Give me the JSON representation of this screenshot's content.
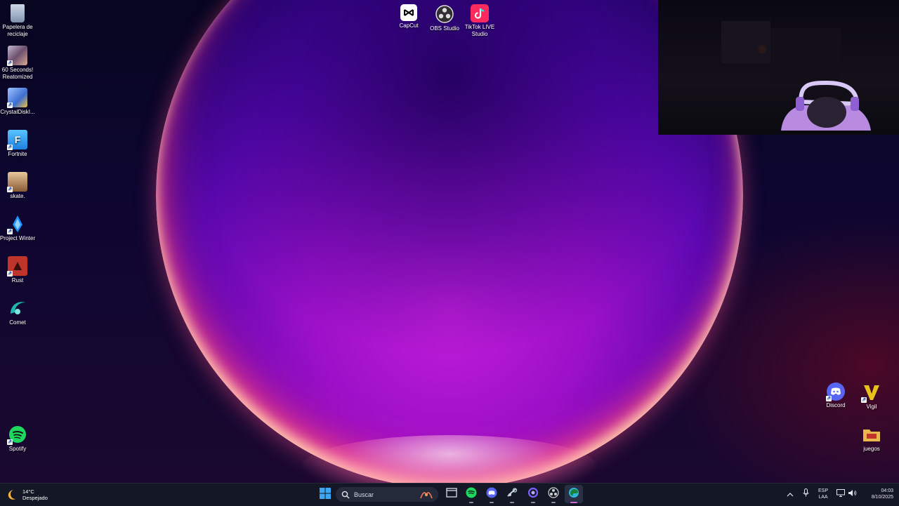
{
  "desktop": {
    "icons_left": [
      {
        "label": "Papelera de reciclaje",
        "icon": "recycle-bin-icon",
        "color": "#9fb6cf"
      },
      {
        "label": "60 Seconds! Reatomized",
        "icon": "game-60-seconds-icon",
        "color": "#8a6d8c"
      },
      {
        "label": "CrystalDiskI...",
        "icon": "crystaldiskinfo-icon",
        "color": "#4d7dd1"
      },
      {
        "label": "Fortnite",
        "icon": "fortnite-icon",
        "color": "#3aa0f2"
      },
      {
        "label": "skate.",
        "icon": "skate-icon",
        "color": "#b88a5d"
      },
      {
        "label": "Project Winter",
        "icon": "project-winter-icon",
        "color": "#1e90ff"
      },
      {
        "label": "Rust",
        "icon": "rust-icon",
        "color": "#c0352b"
      },
      {
        "label": "Comet",
        "icon": "comet-icon",
        "color": "#1fb5b0"
      },
      {
        "label": "Spotify",
        "icon": "spotify-icon",
        "color": "#1ed760"
      }
    ],
    "icons_top": [
      {
        "label": "CapCut",
        "icon": "capcut-icon",
        "color": "#ffffff"
      },
      {
        "label": "OBS Studio",
        "icon": "obs-studio-icon",
        "color": "#302e31"
      },
      {
        "label": "TikTok LIVE Studio",
        "icon": "tiktok-live-icon",
        "color": "#ff2b5e"
      }
    ],
    "icons_right": [
      {
        "label": "Discord",
        "icon": "discord-icon",
        "color": "#5865f2"
      },
      {
        "label": "Vigil",
        "icon": "vigil-icon",
        "color": "#e8c21a"
      },
      {
        "label": "juegos",
        "icon": "folder-icon",
        "color": "#e8b84a"
      }
    ]
  },
  "taskbar": {
    "weather": {
      "temp": "14°C",
      "condition": "Despejado",
      "icon": "moon-icon"
    },
    "search_placeholder": "Buscar",
    "apps": [
      {
        "name": "file-explorer",
        "icon": "file-explorer-icon",
        "color": "#d9dde6"
      },
      {
        "name": "spotify",
        "icon": "spotify-icon",
        "color": "#1ed760"
      },
      {
        "name": "discord",
        "icon": "discord-icon",
        "color": "#5865f2"
      },
      {
        "name": "steam",
        "icon": "steam-icon",
        "color": "#c7d5e0"
      },
      {
        "name": "comet",
        "icon": "comet-icon",
        "color": "#7b61ff"
      },
      {
        "name": "obs-studio",
        "icon": "obs-studio-icon",
        "color": "#d0d0d0"
      },
      {
        "name": "edge",
        "icon": "edge-icon",
        "color": "#2fb6d8"
      }
    ],
    "tray": {
      "language_top": "ESP",
      "language_bottom": "LAA",
      "time": "04:03",
      "date": "8/10/2025"
    }
  },
  "colors": {
    "taskbar_bg": "#141826",
    "accent": "#0078d4"
  }
}
